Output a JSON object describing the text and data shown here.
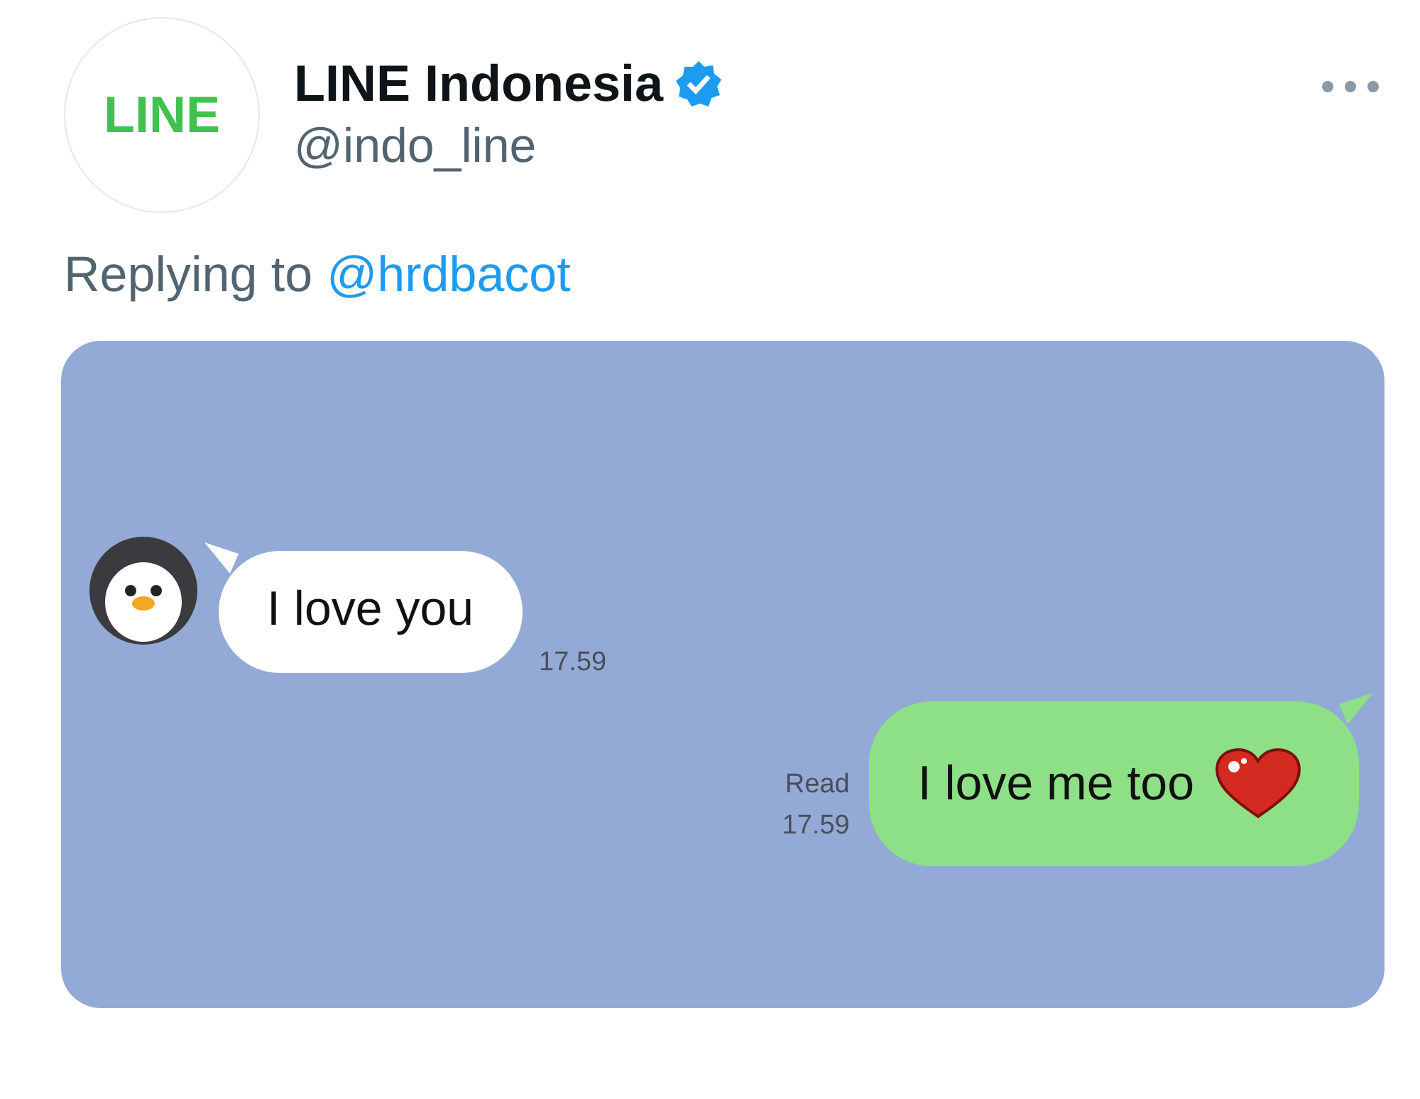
{
  "account": {
    "avatar_text": "LINE",
    "name": "LINE Indonesia",
    "verified": true,
    "handle": "@indo_line"
  },
  "reply": {
    "prefix": "Replying to",
    "mention": "@hrdbacot"
  },
  "chat": {
    "messages": [
      {
        "kind": "received",
        "text": "I love you",
        "time": "17.59"
      },
      {
        "kind": "sent",
        "text": "I love me too",
        "read": "Read",
        "time": "17.59"
      }
    ]
  }
}
